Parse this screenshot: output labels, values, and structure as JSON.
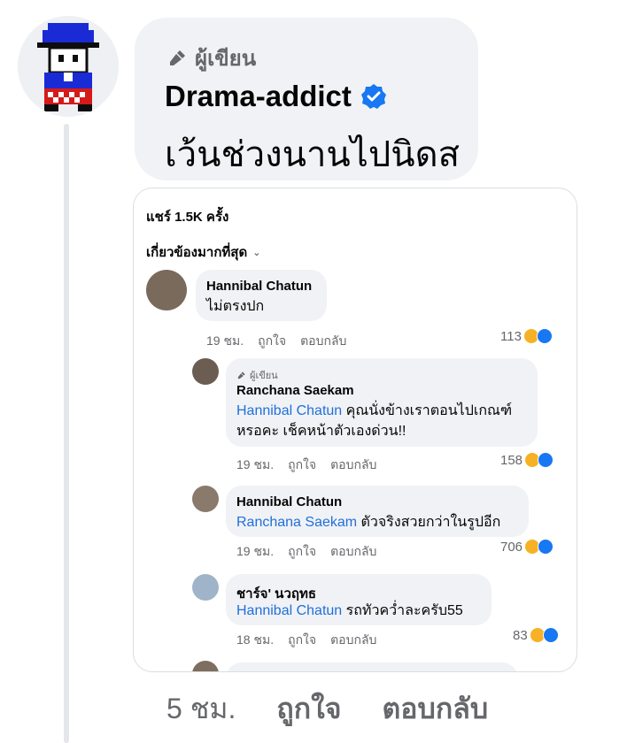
{
  "post": {
    "author_badge": "ผู้เขียน",
    "author_name": "Drama-addict",
    "comment": "เว้นช่วงนานไปนิดส",
    "footer": {
      "time": "5 ชม.",
      "like": "ถูกใจ",
      "reply": "ตอบกลับ"
    }
  },
  "card": {
    "share_count": "แชร์ 1.5K ครั้ง",
    "sort_label": "เกี่ยวข้องมากที่สุด",
    "comments": [
      {
        "name": "Hannibal Chatun",
        "text": "ไม่ตรงปก",
        "time": "19 ชม.",
        "like": "ถูกใจ",
        "reply": "ตอบกลับ",
        "reactions": "113"
      },
      {
        "badge": "ผู้เขียน",
        "name": "Ranchana Saekam",
        "mention": "Hannibal Chatun",
        "text_line1": " คุณนั่งข้างเราตอนไปเกณฑ์",
        "text_line2": "หรอคะ เช็คหน้าตัวเองด่วน!!",
        "time": "19 ชม.",
        "like": "ถูกใจ",
        "reply": "ตอบกลับ",
        "reactions": "158"
      },
      {
        "name": "Hannibal Chatun",
        "mention": "Ranchana Saekam",
        "text": " ตัวจริงสวยกว่าในรูปอีก",
        "time": "19 ชม.",
        "like": "ถูกใจ",
        "reply": "ตอบกลับ",
        "reactions": "706"
      },
      {
        "name": "ชาร์จ' นวฤทธ",
        "mention": "Hannibal Chatun",
        "text": " รถทัวคว่ำละครับ55",
        "time": "18 ชม.",
        "like": "ถูกใจ",
        "reply": "ตอบกลับ",
        "reactions": "83"
      }
    ]
  },
  "colors": {
    "accent": "#1877f2",
    "mention": "#216fdb",
    "bubble": "#f0f2f5",
    "meta": "#65676b"
  }
}
